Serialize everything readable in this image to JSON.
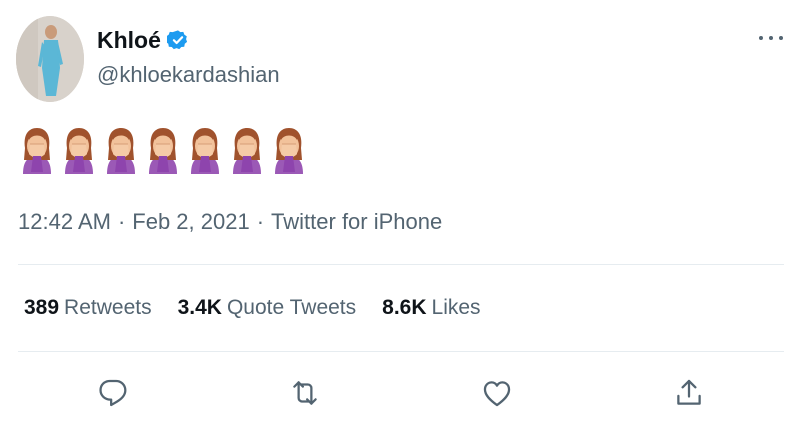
{
  "user": {
    "name": "Khloé",
    "handle": "@khloekardashian",
    "verified": true
  },
  "tweet": {
    "content_emoji": [
      "face-palm-woman-emoji",
      "face-palm-woman-emoji",
      "face-palm-woman-emoji",
      "face-palm-woman-emoji",
      "face-palm-woman-emoji",
      "face-palm-woman-emoji",
      "face-palm-woman-emoji"
    ],
    "time": "12:42 AM",
    "date": "Feb 2, 2021",
    "source": "Twitter for iPhone",
    "separator": "·"
  },
  "stats": {
    "retweets_count": "389",
    "retweets_label": "Retweets",
    "quotes_count": "3.4K",
    "quotes_label": "Quote Tweets",
    "likes_count": "8.6K",
    "likes_label": "Likes"
  },
  "actions": [
    "reply-icon",
    "retweet-icon",
    "like-icon",
    "share-icon"
  ],
  "colors": {
    "text": "#0f1419",
    "secondary": "#536471",
    "verified": "#1d9bf0",
    "divider": "#e6ecf0",
    "emoji_sleeve": "#9b59b6",
    "emoji_hair": "#a0522d",
    "emoji_skin": "#f2c29b"
  }
}
